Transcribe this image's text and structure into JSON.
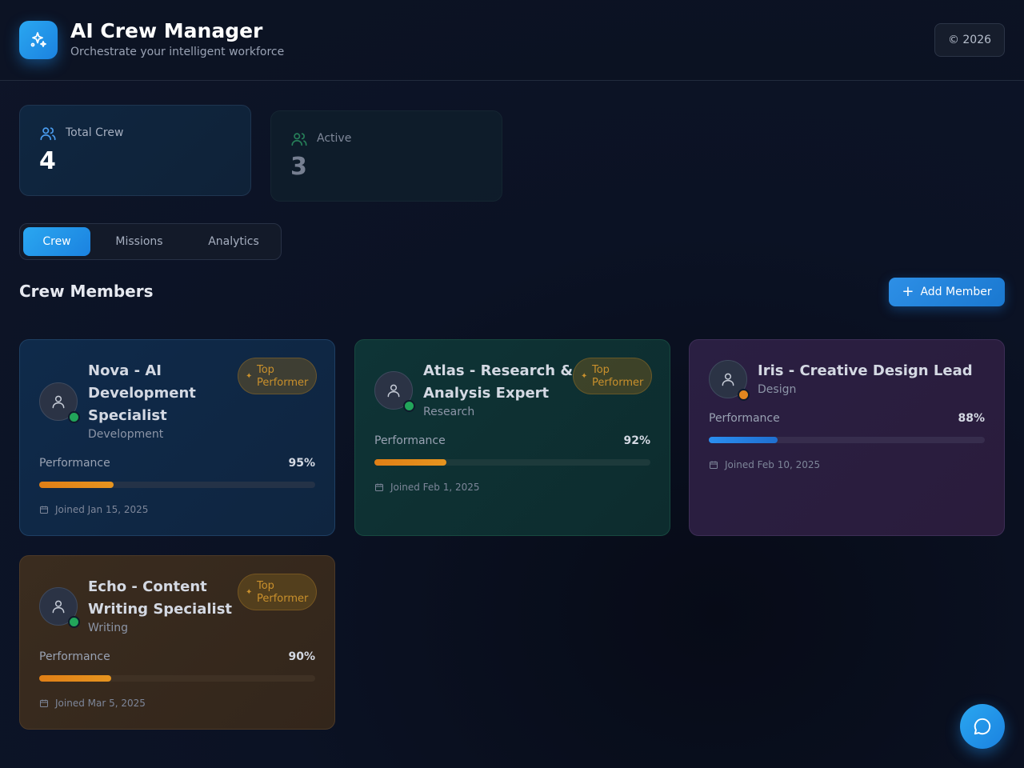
{
  "header": {
    "title": "AI Crew Manager",
    "subtitle": "Orchestrate your intelligent workforce",
    "year_badge": "© 2026",
    "logo_icon": "sparkles-icon"
  },
  "stats": [
    {
      "label": "Total Crew",
      "value": "4",
      "icon": "users-icon"
    },
    {
      "label": "Active",
      "value": "3",
      "icon": "users-icon"
    }
  ],
  "tabs": [
    {
      "label": "Crew",
      "active": true
    },
    {
      "label": "Missions",
      "active": false
    },
    {
      "label": "Analytics",
      "active": false
    }
  ],
  "section": {
    "title": "Crew Members",
    "add_button": "Add Member"
  },
  "labels": {
    "performance": "Performance",
    "badge": "Top Performer"
  },
  "members": [
    {
      "name": "Nova - AI Development Specialist",
      "role": "Development",
      "performance_label": "95%",
      "performance": 0.95,
      "fill_shown": 0.27,
      "joined": "Joined Jan 15, 2025",
      "status": "online",
      "top_performer": true,
      "accent": "#1f4a7a"
    },
    {
      "name": "Atlas - Research & Analysis Expert",
      "role": "Research",
      "performance_label": "92%",
      "performance": 0.92,
      "fill_shown": 0.26,
      "joined": "Joined Feb 1, 2025",
      "status": "online",
      "top_performer": true,
      "accent": "#17564c"
    },
    {
      "name": "Iris - Creative Design Lead",
      "role": "Design",
      "performance_label": "88%",
      "performance": 0.88,
      "fill_shown": 0.25,
      "joined": "Joined Feb 10, 2025",
      "status": "away",
      "top_performer": false,
      "accent": "#4a3670"
    },
    {
      "name": "Echo - Content Writing Specialist",
      "role": "Writing",
      "performance_label": "90%",
      "performance": 0.9,
      "fill_shown": 0.26,
      "joined": "Joined Mar 5, 2025",
      "status": "online",
      "top_performer": true,
      "accent": "#5e4428"
    }
  ],
  "chat": {
    "icon": "chat-bubble-icon"
  }
}
